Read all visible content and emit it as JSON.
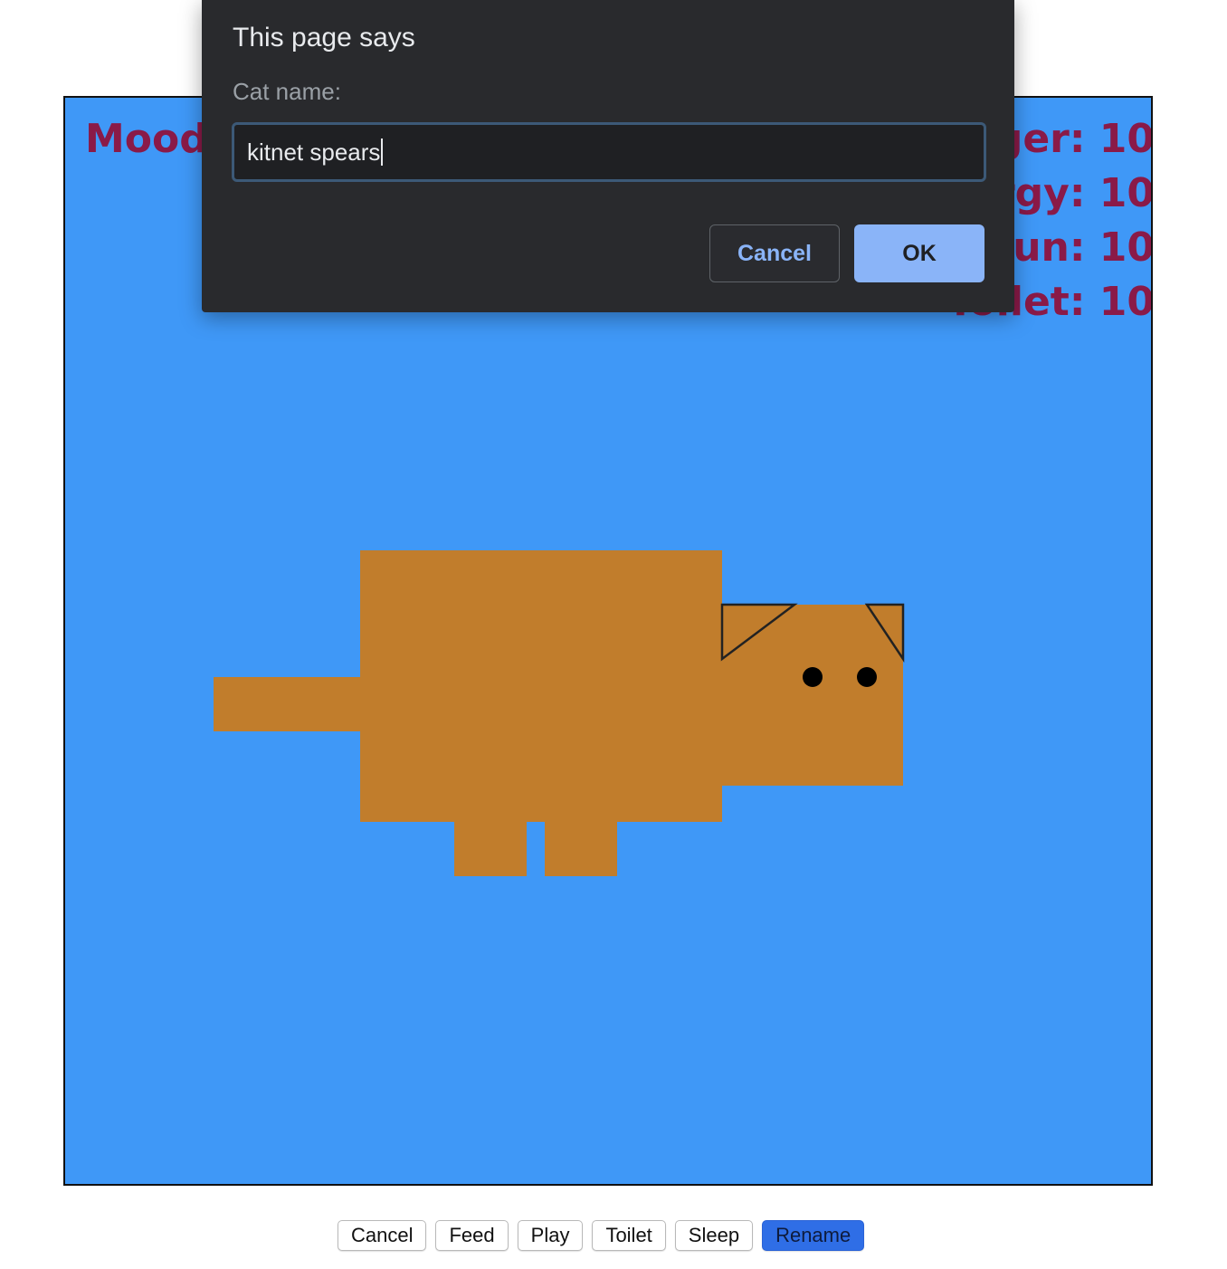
{
  "game": {
    "colors": {
      "background": "#3f98f7",
      "cat_fur": "#c17d2c",
      "cat_outline": "#222222",
      "stat_text": "#8a1a48"
    },
    "stats": {
      "mood_label": "Mood:",
      "hunger_label": "Hunger: 10",
      "energy_label": "Energy: 10",
      "fun_label": "Fun: 10",
      "toilet_label": "Toilet: 10"
    }
  },
  "controls": {
    "cancel_label": "Cancel",
    "feed_label": "Feed",
    "play_label": "Play",
    "toilet_label": "Toilet",
    "sleep_label": "Sleep",
    "rename_label": "Rename",
    "rename_color": "#2f6ee6"
  },
  "dialog": {
    "title": "This page says",
    "prompt_label": "Cat name:",
    "input_value": "kitnet spears",
    "cancel_label": "Cancel",
    "ok_label": "OK",
    "colors": {
      "background": "#292a2d",
      "label": "#9aa0a6",
      "cancel_text": "#8ab4f8",
      "ok_background": "#8ab4f8"
    }
  }
}
